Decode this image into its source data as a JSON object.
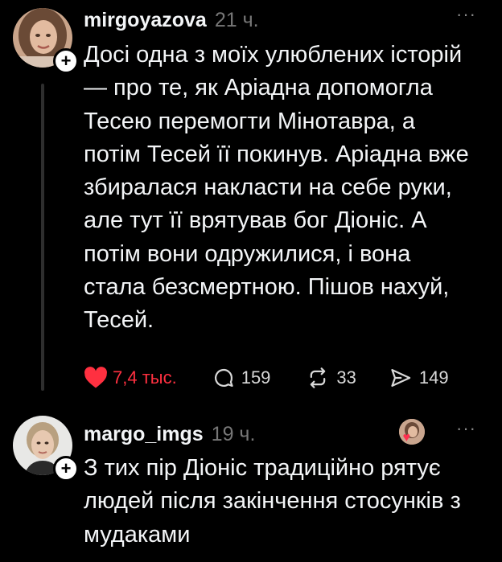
{
  "posts": [
    {
      "username": "mirgoyazova",
      "time": "21 ч.",
      "more_label": "···",
      "text": "Досі одна з моїх улюблених історій\n— про те, як Аріадна допомогла\nТесею перемогти Мінотавра, а\nпотім Тесей її покинув. Аріадна вже\nзбиралася накласти на себе руки,\nале тут її врятував бог Діоніс. А\nпотім вони одружилися, і вона\nстала безсмертною. Пішов нахуй,\nТесей.",
      "follow_badge": "+",
      "actions": {
        "likes": "7,4 тыс.",
        "replies": "159",
        "reposts": "33",
        "shares": "149"
      },
      "icons": [
        "heart-icon",
        "comment-icon",
        "repost-icon",
        "share-icon"
      ]
    },
    {
      "username": "margo_imgs",
      "time": "19 ч.",
      "more_label": "···",
      "follow_badge": "+",
      "reaction_icon": "heart-icon",
      "text": "З тих пір Діоніс традиційно рятує\nлюдей після закінчення стосунків з\nмудаками"
    }
  ],
  "colors": {
    "background": "#000000",
    "text": "#f3f5f7",
    "muted": "#777777",
    "like": "#ff3040"
  }
}
